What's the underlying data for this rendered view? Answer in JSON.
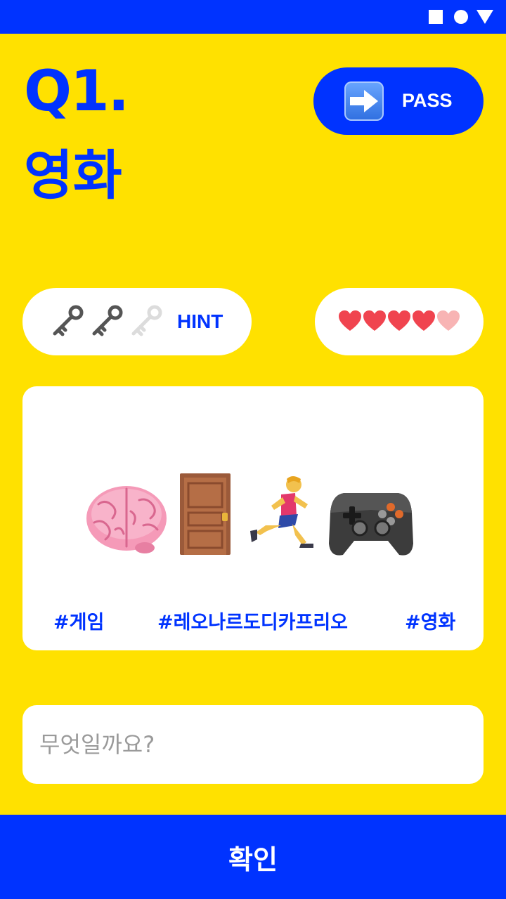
{
  "status_bar": {
    "icons": [
      "square-icon",
      "circle-icon",
      "triangle-icon"
    ]
  },
  "question": {
    "number": "Q1.",
    "category": "영화"
  },
  "pass_button": {
    "label": "PASS",
    "icon": "right-arrow-icon"
  },
  "hint": {
    "label": "HINT",
    "keys_total": 3,
    "keys_remaining": 2
  },
  "lives": {
    "total": 5,
    "remaining": 4
  },
  "puzzle": {
    "emojis": [
      "brain-emoji",
      "door-emoji",
      "running-man-emoji",
      "game-controller-emoji"
    ],
    "tags": [
      "#게임",
      "#레오나르도디카프리오",
      "#영화"
    ]
  },
  "answer_input": {
    "placeholder": "무엇일까요?",
    "value": ""
  },
  "confirm_button": {
    "label": "확인"
  },
  "colors": {
    "background": "#FFE100",
    "accent": "#0033FF",
    "heart_full": "#F0444F",
    "heart_empty": "#F8B4B4"
  }
}
